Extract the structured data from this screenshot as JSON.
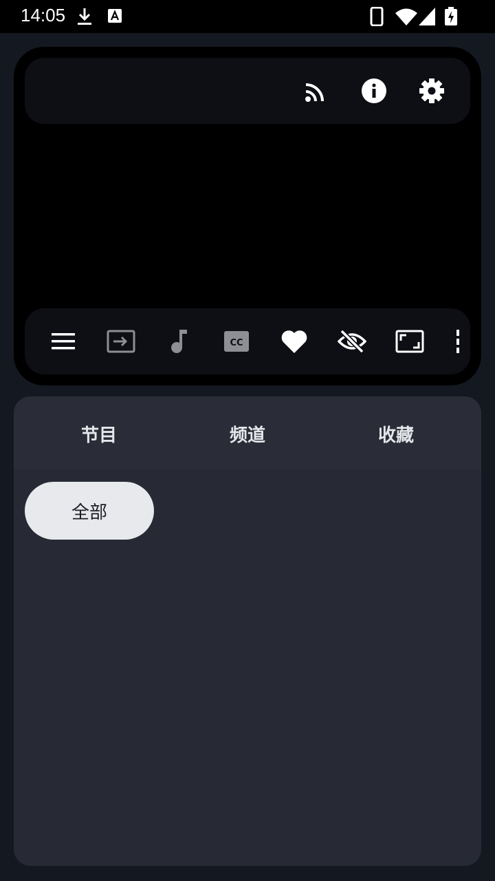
{
  "status_bar": {
    "time": "14:05",
    "left_icons": [
      "download-icon",
      "keyboard-a-icon"
    ],
    "right_icons": [
      "phone-icon",
      "wifi-icon",
      "signal-icon",
      "battery-charging-icon"
    ]
  },
  "player": {
    "top_actions": [
      "cast-icon",
      "info-icon",
      "settings-icon"
    ],
    "controls": [
      "menu-icon",
      "input-icon",
      "audio-track-icon",
      "closed-caption-icon",
      "favorite-icon",
      "visibility-off-icon",
      "aspect-ratio-icon",
      "more-icon"
    ]
  },
  "tabs": [
    {
      "label": "节目"
    },
    {
      "label": "频道"
    },
    {
      "label": "收藏"
    }
  ],
  "filter": {
    "selected": "全部"
  },
  "colors": {
    "background": "#141821",
    "panel": "#272a34",
    "chip": "#e8e9ed"
  }
}
